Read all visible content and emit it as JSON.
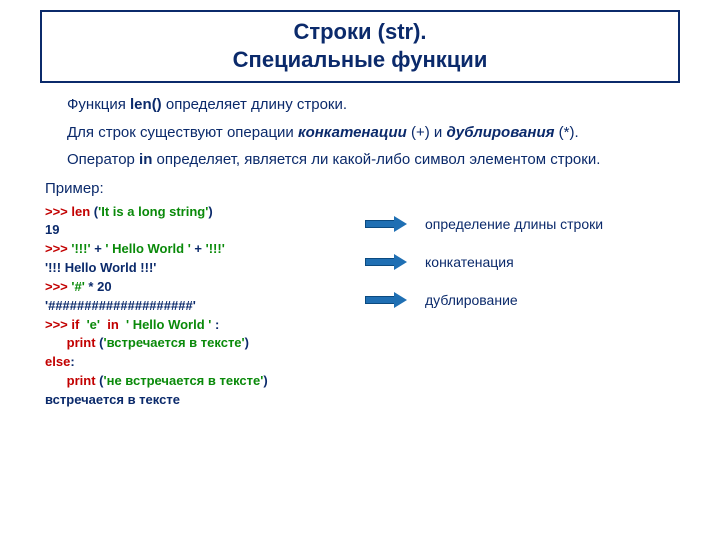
{
  "title_line1": "Строки (str).",
  "title_line2": "Специальные функции",
  "para1": {
    "pre": "Функция ",
    "bold": "len()",
    "post": " определяет длину строки."
  },
  "para2": {
    "pre": "Для строк существуют операции ",
    "bold1": "конкатенации",
    "mid": " (+) и ",
    "bold2": "дублирования",
    "post": " (*)."
  },
  "para3": {
    "pre": "Оператор ",
    "bold": "in",
    "post": " определяет, является ли какой-либо символ элементом строки."
  },
  "example_label": "Пример:",
  "code": {
    "l1_prompt": ">>> ",
    "l1_fn": "len ",
    "l1_paren_open": "(",
    "l1_str": "'It is a long string'",
    "l1_paren_close": ")",
    "l2_out": "19",
    "l3_prompt": ">>> ",
    "l3_s1": "'!!!' ",
    "l3_op1": "+ ",
    "l3_s2": "' Hello World ' ",
    "l3_op2": "+ ",
    "l3_s3": "'!!!'",
    "l4_out": "'!!! Hello World !!!'",
    "l5_prompt": ">>> ",
    "l5_s": "'#' ",
    "l5_op": "* 20",
    "l6_out": "'####################'",
    "l7_prompt": ">>> ",
    "l7_if": "if  ",
    "l7_ch": "'e'  ",
    "l7_in": "in  ",
    "l7_s": "' Hello World ' ",
    "l7_colon": ":",
    "l8_indent": "      ",
    "l8_print": "print ",
    "l8_po": "(",
    "l8_msg": "'встречается в тексте'",
    "l8_pc": ")",
    "l9_else": "else",
    "l9_colon": ":",
    "l10_indent": "      ",
    "l10_print": "print ",
    "l10_po": "(",
    "l10_msg": "'не встречается в тексте'",
    "l10_pc": ")",
    "l11_out": "встречается в тексте"
  },
  "annotations": {
    "a1": "определение длины строки",
    "a2": "конкатенация",
    "a3": "дублирование"
  }
}
